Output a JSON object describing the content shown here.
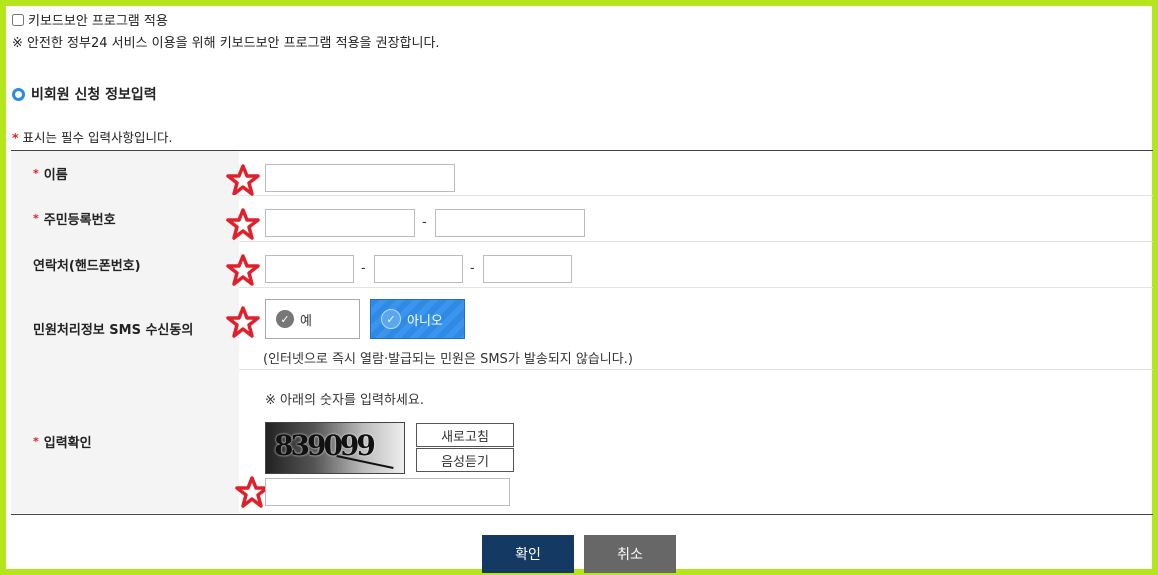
{
  "keyboard_security": {
    "checkbox_label": "키보드보안 프로그램 적용",
    "notice": "※ 안전한 정부24 서비스 이용을 위해 키보드보안 프로그램 적용을 권장합니다."
  },
  "section": {
    "title": "비회원 신청 정보입력",
    "required_notice": "표시는 필수 입력사항입니다.",
    "asterisk": "*"
  },
  "form": {
    "name_label": "이름",
    "rrn_label": "주민등록번호",
    "phone_label": "연락처(핸드폰번호)",
    "sms_label": "민원처리정보 SMS 수신동의",
    "sms_yes": "예",
    "sms_no": "아니오",
    "sms_selected": "아니오",
    "sms_note": "(인터넷으로 즉시 열람·발급되는 민원은 SMS가 발송되지 않습니다.)",
    "captcha_label": "입력확인",
    "captcha_note": "※ 아래의 숫자를 입력하세요.",
    "captcha_text": "839099",
    "refresh_button": "새로고침",
    "audio_button": "음성듣기",
    "dash": "-"
  },
  "buttons": {
    "confirm": "확인",
    "cancel": "취소"
  },
  "colors": {
    "frame": "#b5e61d",
    "accent_blue": "#2f8ae6",
    "confirm": "#143a63",
    "cancel": "#676767",
    "star": "#e0202a"
  }
}
